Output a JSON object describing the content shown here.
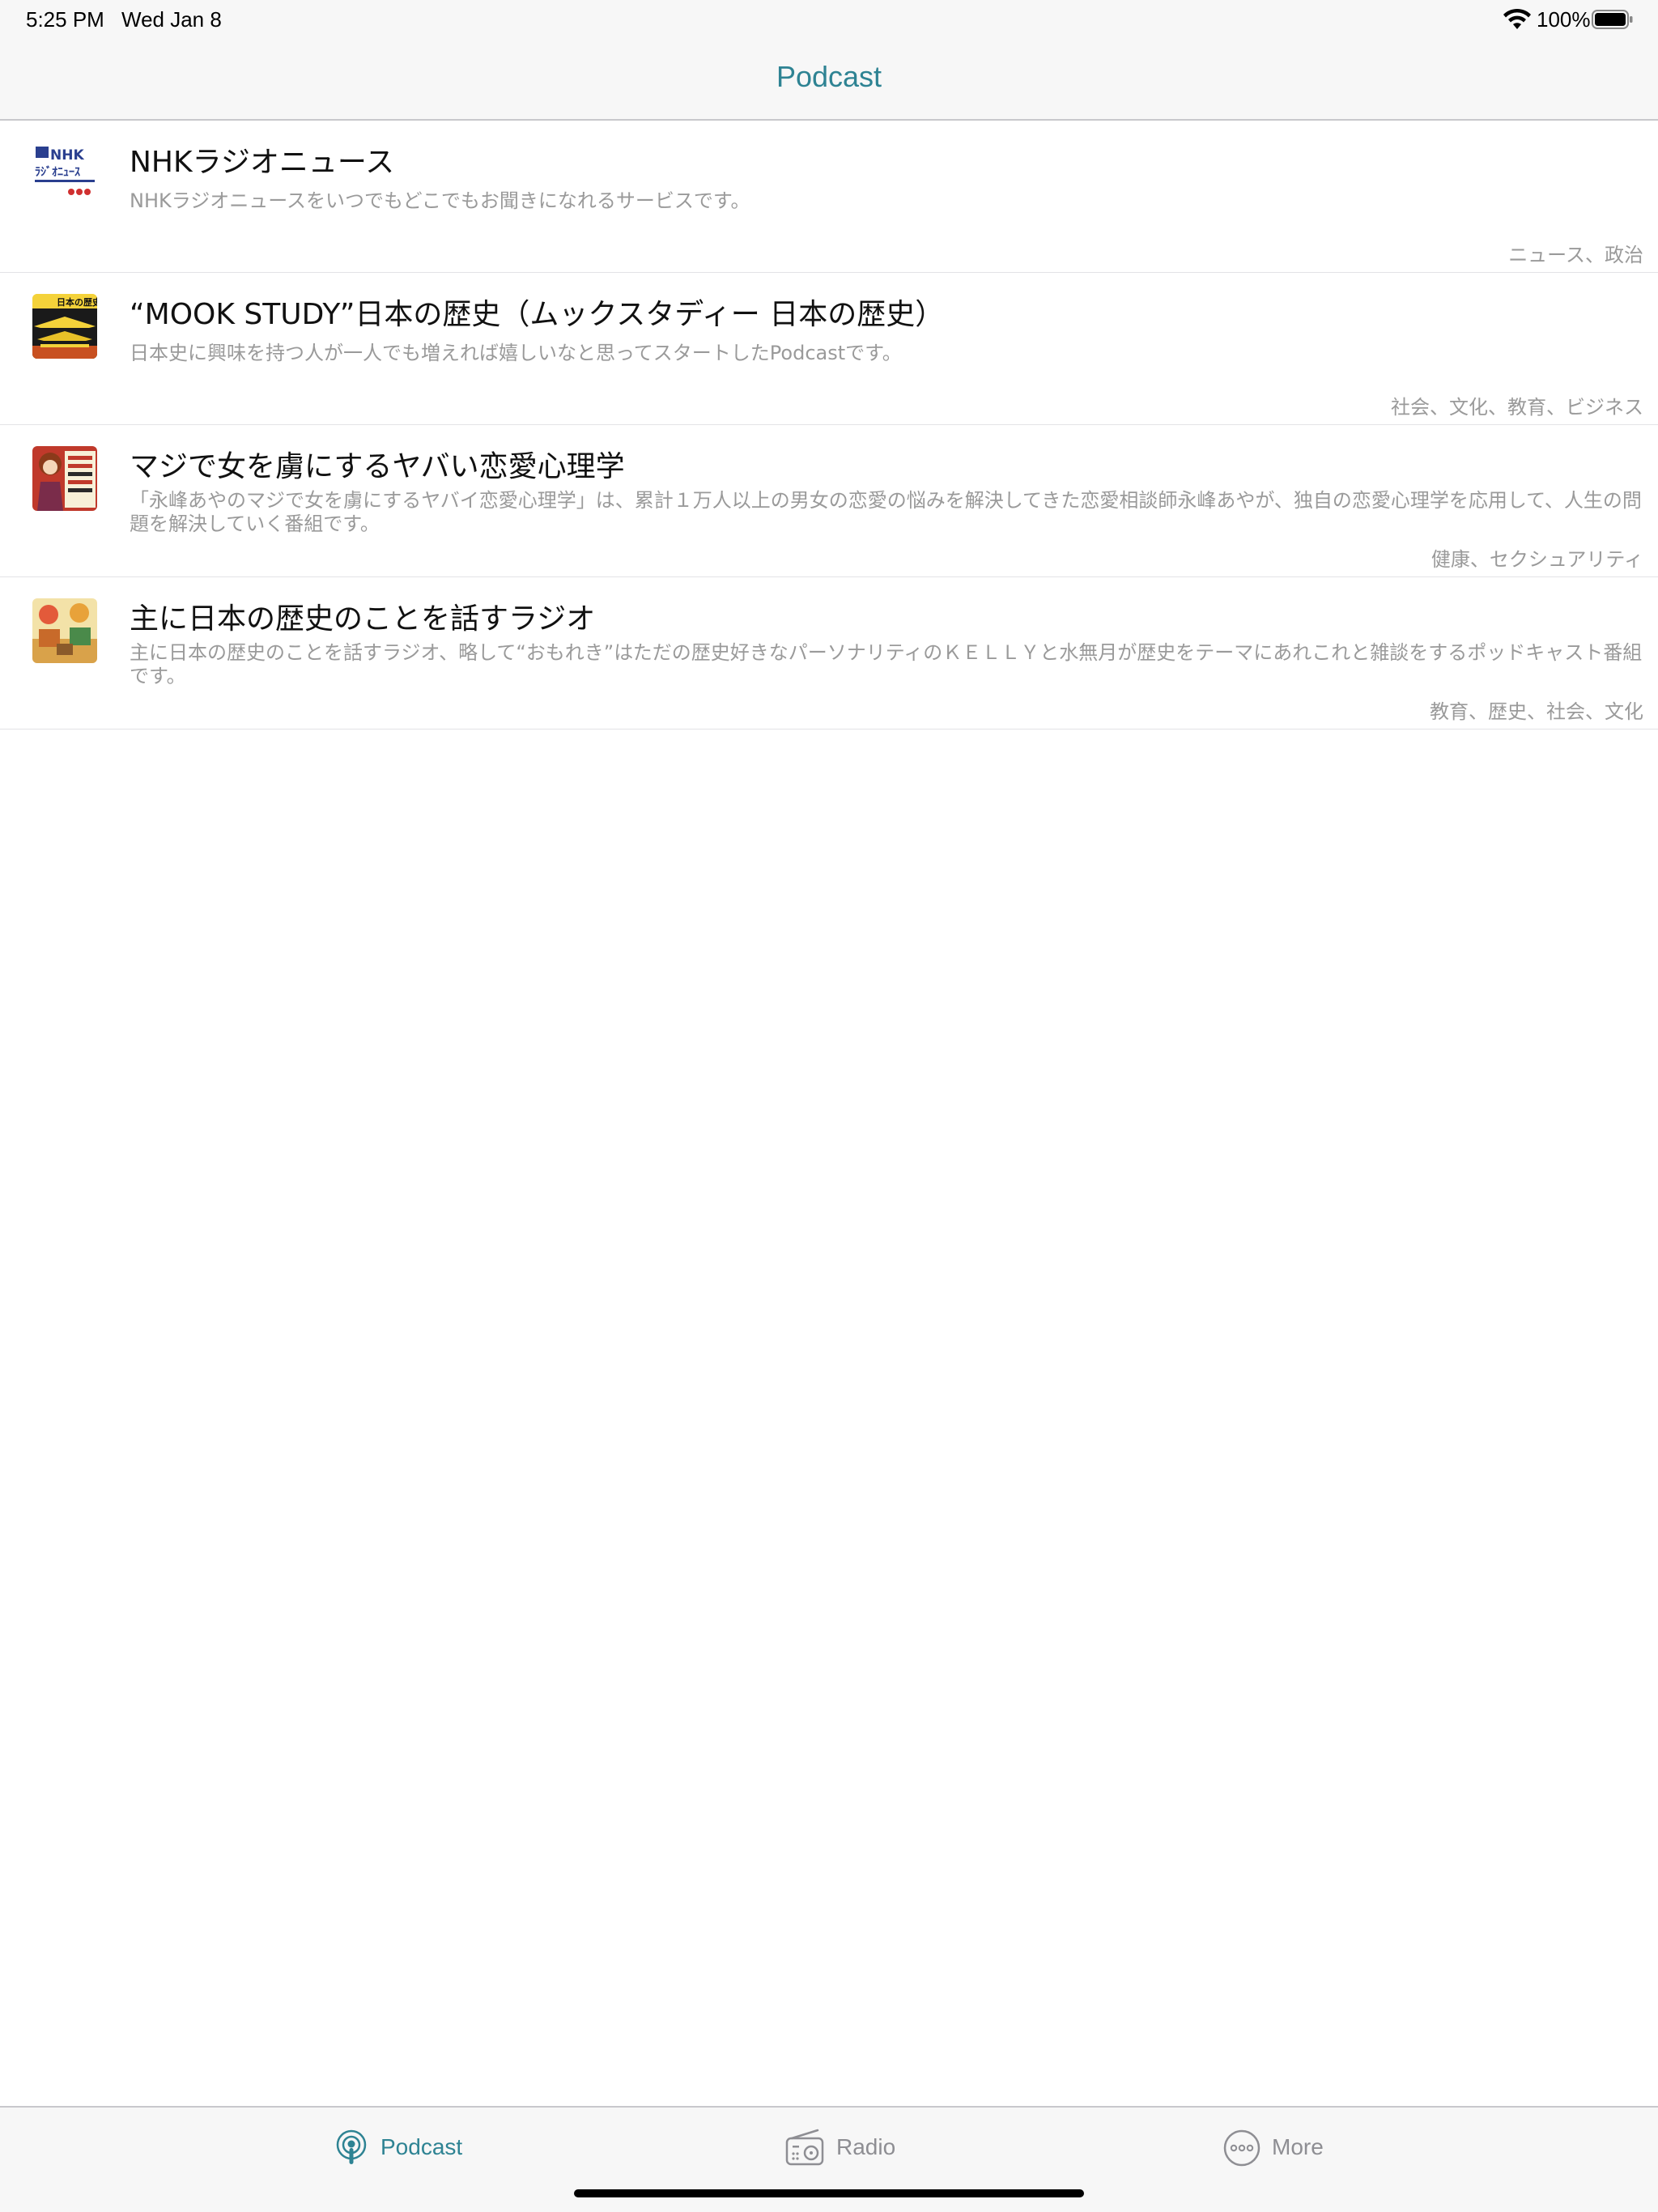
{
  "status_bar": {
    "time": "5:25 PM",
    "date": "Wed Jan 8",
    "battery": "100%"
  },
  "nav": {
    "title": "Podcast"
  },
  "podcasts": [
    {
      "title": "NHKラジオニュース",
      "description": "NHKラジオニュースをいつでもどこでもお聞きになれるサービスです。",
      "categories": "ニュース、政治",
      "thumb_icon": "nhk-radio-news-artwork"
    },
    {
      "title": "“MOOK STUDY”日本の歴史（ムックスタディー 日本の歴史）",
      "description": "日本史に興味を持つ人が一人でも増えれば嬉しいなと思ってスタートしたPodcastです。",
      "categories": "社会、文化、教育、ビジネス",
      "thumb_icon": "mook-study-artwork"
    },
    {
      "title": "マジで女を虜にするヤバい恋愛心理学",
      "description": "「永峰あやのマジで女を虜にするヤバイ恋愛心理学」は、累計１万人以上の男女の恋愛の悩みを解決してきた恋愛相談師永峰あやが、独自の恋愛心理学を応用して、人生の問題を解決していく番組です。",
      "categories": "健康、セクシュアリティ",
      "thumb_icon": "love-psychology-artwork"
    },
    {
      "title": "主に日本の歴史のことを話すラジオ",
      "description": "主に日本の歴史のことを話すラジオ、略して“おもれき”はただの歴史好きなパーソナリティのＫＥＬＬＹと水無月が歴史をテーマにあれこれと雑談をするポッドキャスト番組です。",
      "categories": "教育、歴史、社会、文化",
      "thumb_icon": "omoreki-artwork"
    }
  ],
  "tabs": {
    "podcast": "Podcast",
    "radio": "Radio",
    "more": "More"
  },
  "colors": {
    "accent": "#2e8393",
    "inactive": "#8e8e93",
    "secondary_text": "#9a9a9a"
  }
}
